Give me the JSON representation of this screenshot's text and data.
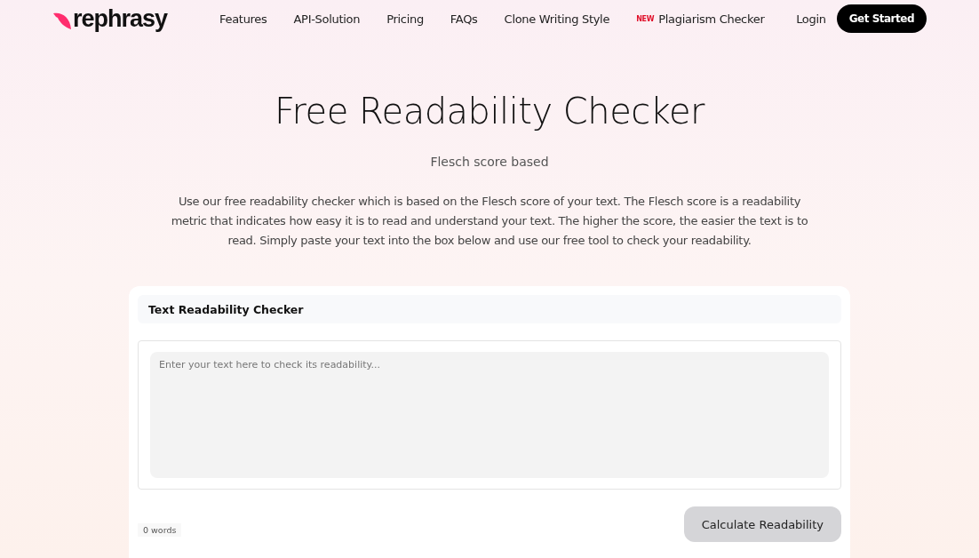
{
  "header": {
    "logo": "rephrasy",
    "nav": [
      {
        "label": "Features"
      },
      {
        "label": "API-Solution"
      },
      {
        "label": "Pricing"
      },
      {
        "label": "FAQs"
      },
      {
        "label": "Clone Writing Style"
      },
      {
        "label": "Plagiarism Checker",
        "badge": "NEW"
      }
    ],
    "login": "Login",
    "cta": "Get Started"
  },
  "hero": {
    "title": "Free Readability Checker",
    "subtitle": "Flesch score based",
    "description": "Use our free readability checker which is based on the Flesch score of your text. The Flesch score is a readability metric that indicates how easy it is to read and understand your text. The higher the score, the easier the text is to read. Simply paste your text into the box below and use our free tool to check your readability."
  },
  "checker": {
    "title": "Text Readability Checker",
    "placeholder": "Enter your text here to check its readability...",
    "word_count": "0 words",
    "button": "Calculate Readability"
  }
}
